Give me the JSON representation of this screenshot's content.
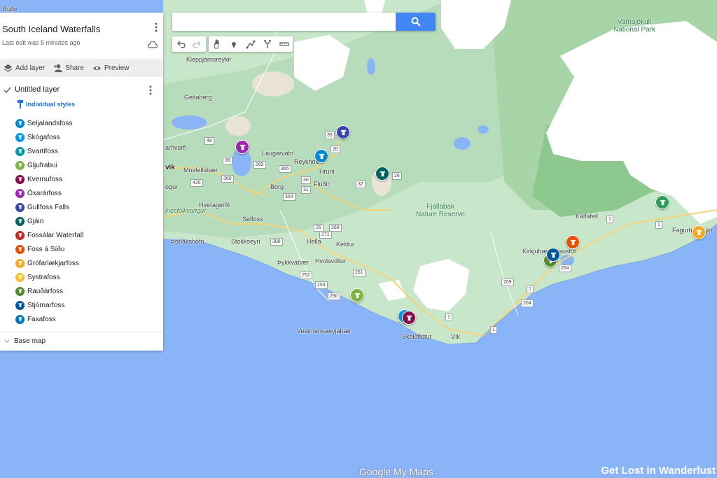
{
  "panel": {
    "title": "South Iceland Waterfalls",
    "last_edit": "Last edit was 5 minutes ago",
    "actions": {
      "add_layer": "Add layer",
      "share": "Share",
      "preview": "Preview"
    },
    "layer": {
      "name": "Untitled layer",
      "styles_label": "Individual styles",
      "places": [
        {
          "name": "Seljalandsfoss",
          "color": "#0288d1"
        },
        {
          "name": "Skógafoss",
          "color": "#039be5"
        },
        {
          "name": "Svartifoss",
          "color": "#0097a7"
        },
        {
          "name": "Gljufrabui",
          "color": "#7cb342"
        },
        {
          "name": "Kvernufoss",
          "color": "#880e4f"
        },
        {
          "name": "Öxarárfoss",
          "color": "#9c27b0"
        },
        {
          "name": "Gullfoss Falls",
          "color": "#3949ab"
        },
        {
          "name": "Gjáin",
          "color": "#006064"
        },
        {
          "name": "Fossálar Waterfall",
          "color": "#c62828"
        },
        {
          "name": "Foss á Síðu",
          "color": "#e65100"
        },
        {
          "name": "Gróf­arlækjarfoss",
          "color": "#f9a825"
        },
        {
          "name": "Systrafoss",
          "color": "#fbc02d"
        },
        {
          "name": "Rauðárfoss",
          "color": "#558b2f"
        },
        {
          "name": "Stjórnarfoss",
          "color": "#01579b"
        },
        {
          "name": "Faxafoss",
          "color": "#0277bd"
        }
      ]
    },
    "base_map": "Base map"
  },
  "search": {
    "placeholder": ""
  },
  "map_labels": {
    "budir": "Búðir",
    "kleppjarnsreykir": "Kleppjárnsreykir",
    "geitaberg": "Geitaberg",
    "laugarvatn": "Laugarvatn",
    "reykholt": "Reykholt",
    "hruni": "Hruni",
    "fludir": "Flúðir",
    "mosfellsbaer": "Mosfellsbær",
    "hveragerdi": "Hveragerði",
    "borg": "Borg",
    "selfoss": "Selfoss",
    "stokkseyri": "Stokkseyri",
    "thorlakshofn": "Þorlákshöfn",
    "hella": "Hella",
    "keldur": "Keldur",
    "thykkvabaer": "Þykkvabær",
    "hvolsvollur": "Hvolsvöllur",
    "vestmannaeyjabaer": "Vestmannaeyjabær",
    "skeidflotur": "Skeiðflötur",
    "vik": "Vík",
    "kirkjubaejarklaustur": "Kirkjubæjarklaustur",
    "kalfafell": "Kálfafell",
    "fagurholsmyri": "Fagurhólsmýri",
    "vik_left": "vik",
    "arnarhverfi": "arhverfi",
    "kogur": "ogur",
    "thjodgardur": "inesfólkvangur",
    "fjallabak": "Fjallabak\nNature Reserve",
    "vatnajokull": "Vatnajökull\nNational Park"
  },
  "roads": [
    "35",
    "20",
    "26",
    "265",
    "365",
    "30",
    "32",
    "31",
    "354",
    "360",
    "435",
    "48",
    "36",
    "26",
    "268",
    "308",
    "271",
    "261",
    "252",
    "253",
    "250",
    "204",
    "209",
    "264",
    "1",
    "1",
    "1",
    "1",
    "1"
  ],
  "brand": "Google My Maps",
  "watermark": "Get Lost in Wanderlust"
}
